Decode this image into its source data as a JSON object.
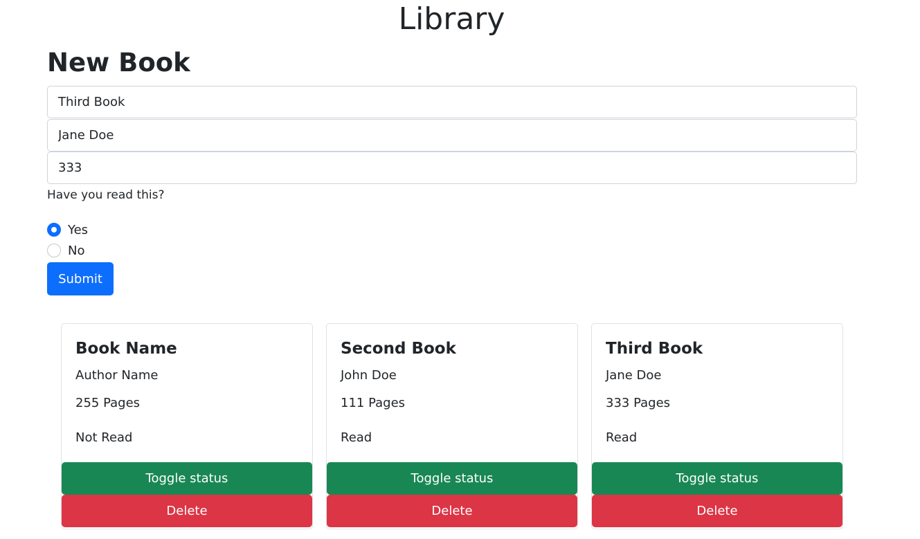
{
  "page": {
    "title": "Library"
  },
  "form": {
    "heading": "New Book",
    "title_value": "Third Book",
    "author_value": "Jane Doe",
    "pages_value": "333",
    "question": "Have you read this?",
    "options": [
      {
        "label": "Yes",
        "checked": true
      },
      {
        "label": "No",
        "checked": false
      }
    ],
    "submit_label": "Submit"
  },
  "books": [
    {
      "title": "Book Name",
      "author": "Author Name",
      "pages": "255 Pages",
      "status": "Not Read",
      "toggle_label": "Toggle status",
      "delete_label": "Delete"
    },
    {
      "title": "Second Book",
      "author": "John Doe",
      "pages": "111 Pages",
      "status": "Read",
      "toggle_label": "Toggle status",
      "delete_label": "Delete"
    },
    {
      "title": "Third Book",
      "author": "Jane Doe",
      "pages": "333 Pages",
      "status": "Read",
      "toggle_label": "Toggle status",
      "delete_label": "Delete"
    }
  ],
  "colors": {
    "primary": "#0d6efd",
    "success": "#198754",
    "danger": "#dc3545",
    "text": "#212529"
  }
}
